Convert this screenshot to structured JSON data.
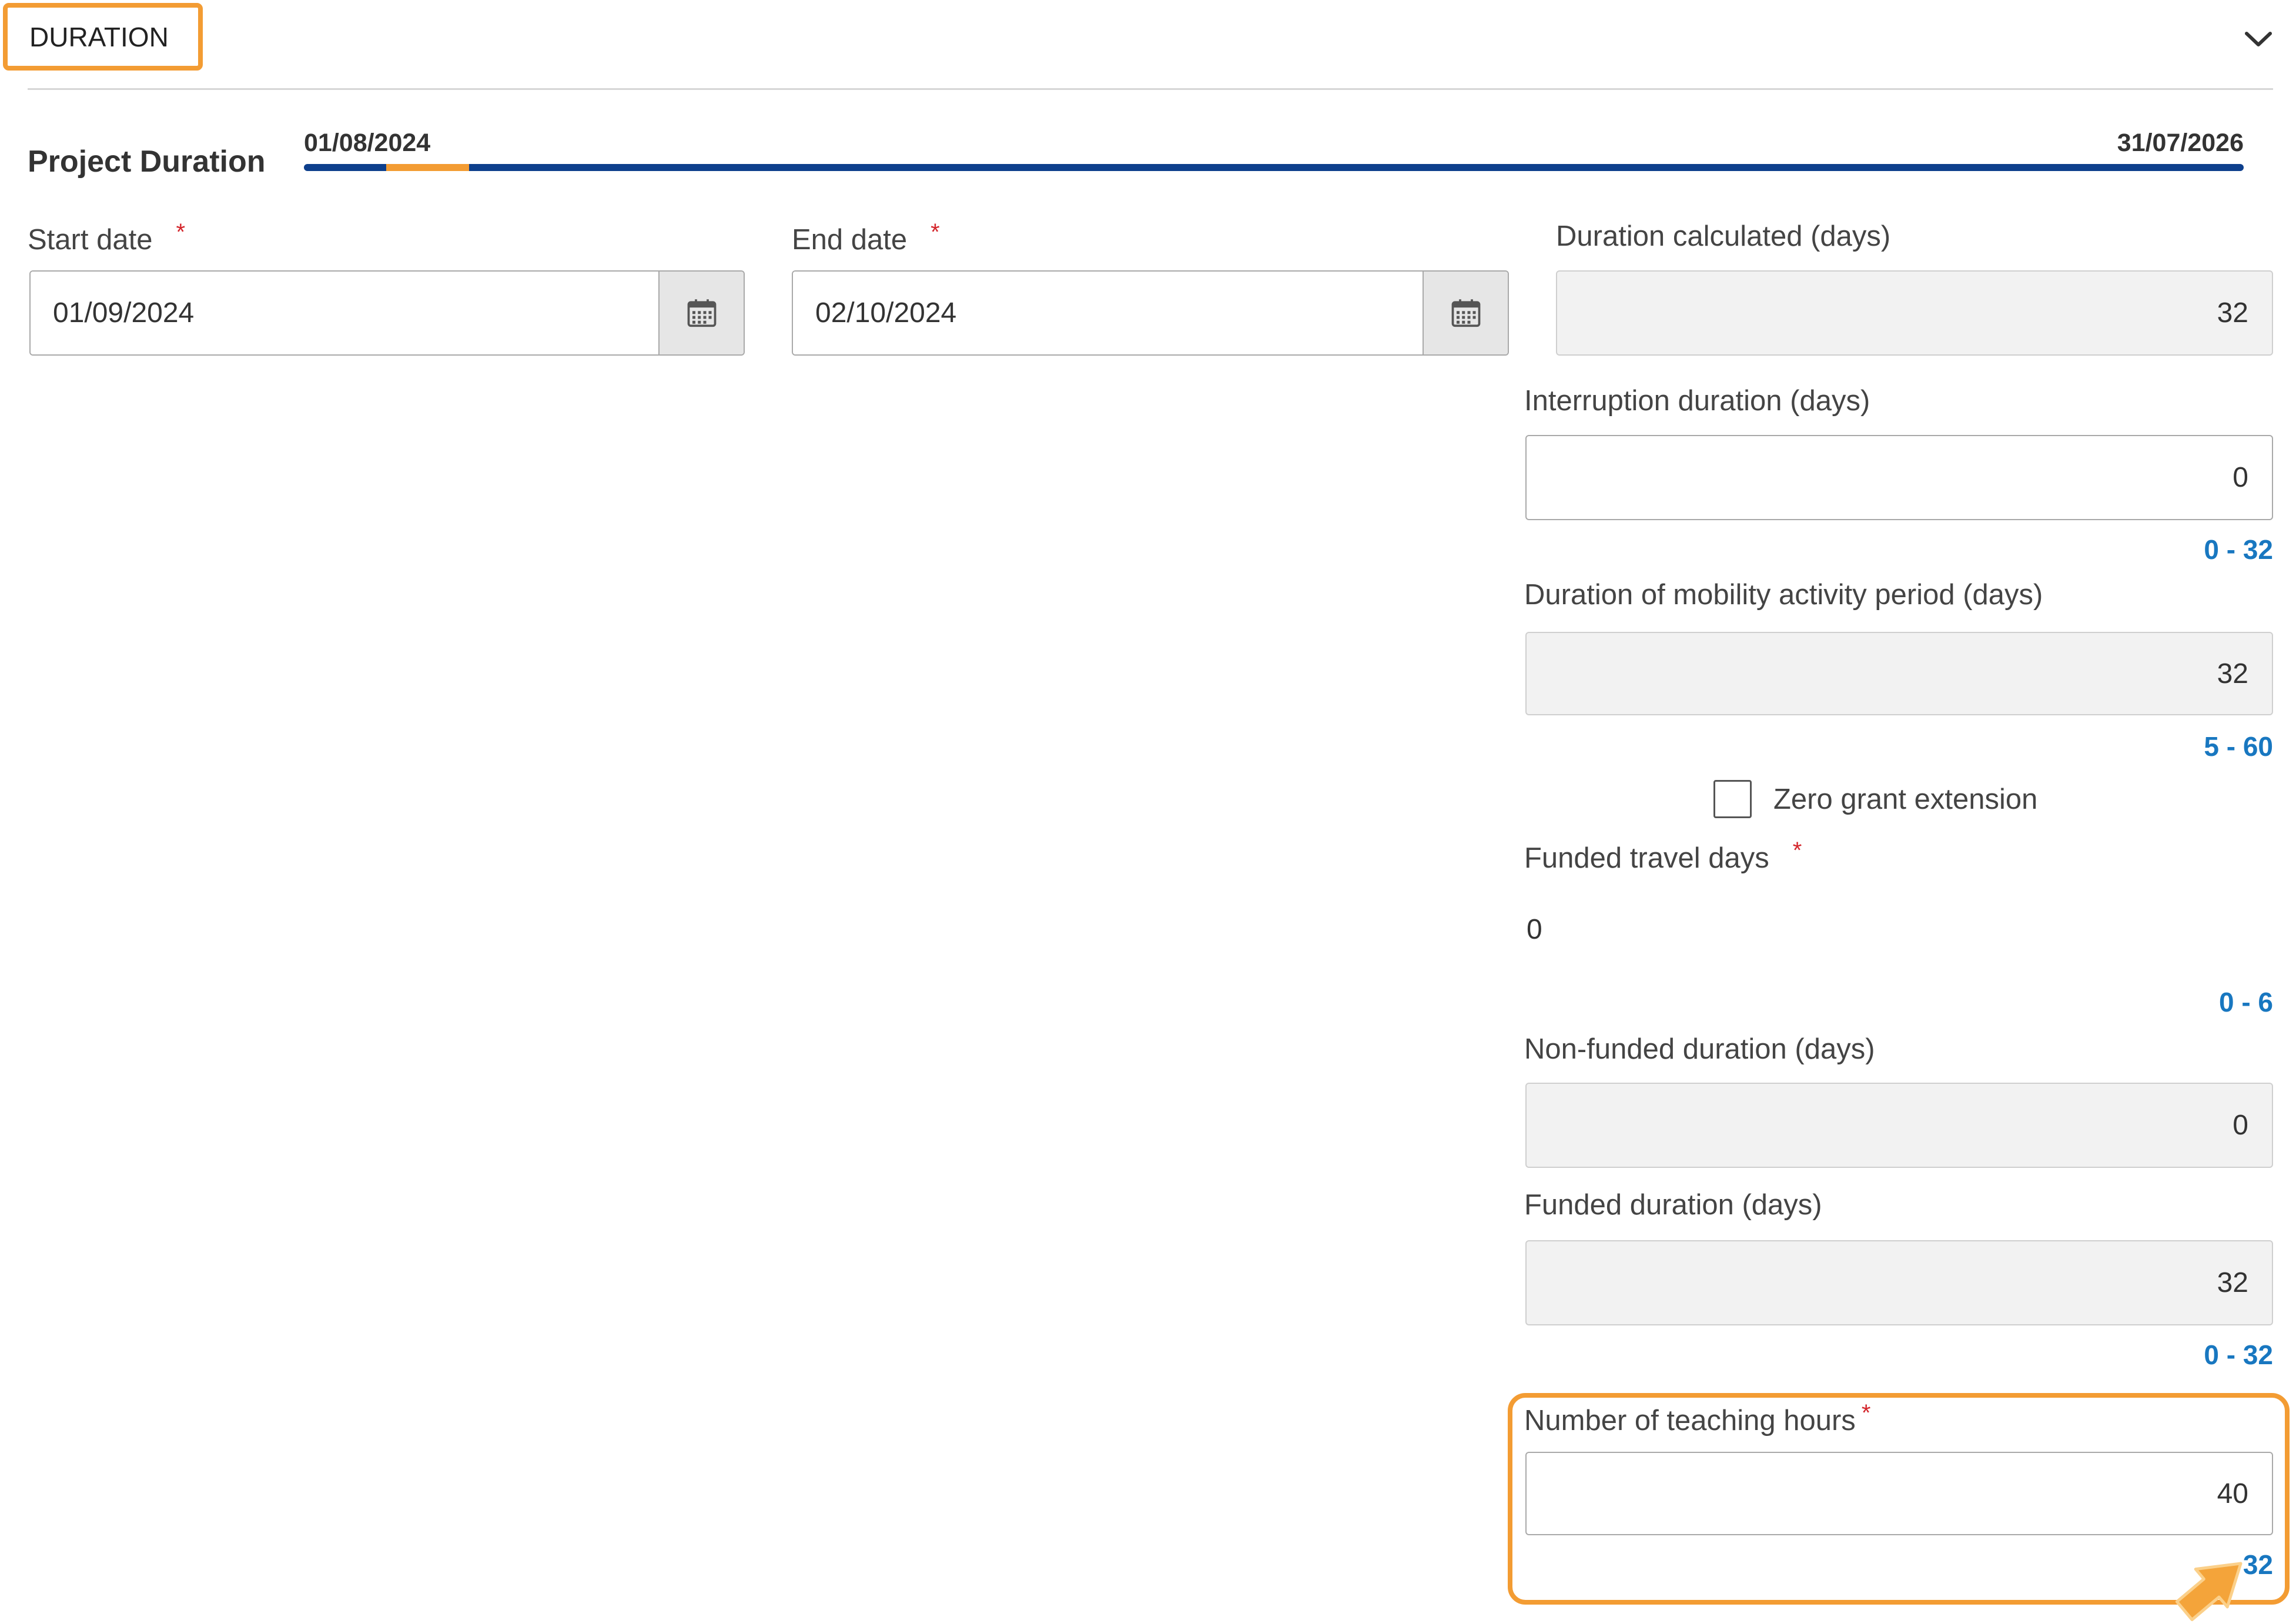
{
  "section": {
    "title": "DURATION",
    "toggle_icon": "chevron-down-icon"
  },
  "project_duration": {
    "label": "Project Duration",
    "start": "01/08/2024",
    "end": "31/07/2026"
  },
  "fields": {
    "start_date": {
      "label": "Start date",
      "required_mark": "*",
      "value": "01/09/2024",
      "icon": "calendar-icon"
    },
    "end_date": {
      "label": "End date",
      "required_mark": "*",
      "value": "02/10/2024",
      "icon": "calendar-icon"
    },
    "duration_calculated": {
      "label": "Duration calculated (days)",
      "value": "32"
    },
    "interruption_duration": {
      "label": "Interruption duration (days)",
      "value": "0",
      "range": "0 - 32"
    },
    "mobility_activity_period": {
      "label": "Duration of mobility activity period (days)",
      "value": "32",
      "range": "5 - 60"
    },
    "zero_grant_extension": {
      "label": "Zero grant extension",
      "checked": false
    },
    "funded_travel_days": {
      "label": "Funded travel days",
      "required_mark": "*",
      "value": "0",
      "range": "0 - 6"
    },
    "non_funded_duration": {
      "label": "Non-funded duration (days)",
      "value": "0"
    },
    "funded_duration": {
      "label": "Funded duration (days)",
      "value": "32",
      "range": "0 - 32"
    },
    "teaching_hours": {
      "label": "Number of teaching hours",
      "required_mark": "*",
      "value": "40",
      "range": "32"
    }
  },
  "overlay": {
    "pointer_icon": "arrow-pointer-icon"
  },
  "colors": {
    "accent": "#f39c33",
    "timeline_bar": "#0d3f8c",
    "timeline_segment": "#f39c33",
    "range_text": "#1877c0",
    "required": "#d4262c",
    "readonly_bg": "#f2f2f2"
  }
}
